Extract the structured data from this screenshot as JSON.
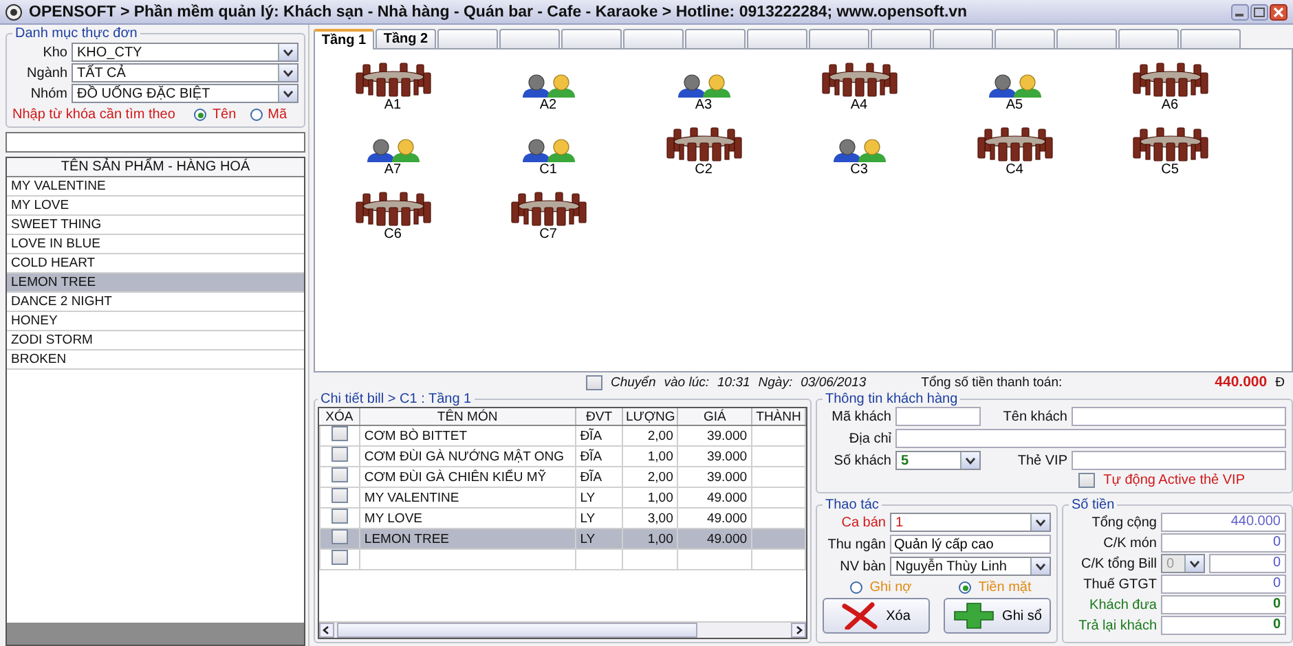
{
  "window": {
    "title": "OPENSOFT > Phần mềm quản lý: Khách sạn - Nhà hàng - Quán bar - Cafe - Karaoke > Hotline: 0913222284; www.opensoft.vn"
  },
  "menu_panel": {
    "title": "Danh mục thực đơn",
    "filters": [
      {
        "label": "Kho",
        "value": "KHO_CTY"
      },
      {
        "label": "Ngành",
        "value": "TẤT CẢ"
      },
      {
        "label": "Nhóm",
        "value": "ĐỒ UỐNG ĐẶC BIỆT"
      }
    ],
    "search_label": "Nhập từ khóa cần tìm theo",
    "search_by": [
      {
        "label": "Tên",
        "selected": true
      },
      {
        "label": "Mã",
        "selected": false
      }
    ]
  },
  "products": {
    "header": "TÊN SẢN PHẨM - HÀNG HOÁ",
    "items": [
      {
        "name": "MY VALENTINE",
        "selected": false
      },
      {
        "name": "MY LOVE",
        "selected": false
      },
      {
        "name": "SWEET THING",
        "selected": false
      },
      {
        "name": "LOVE IN BLUE",
        "selected": false
      },
      {
        "name": "COLD HEART",
        "selected": false
      },
      {
        "name": "LEMON TREE",
        "selected": true
      },
      {
        "name": "DANCE 2 NIGHT",
        "selected": false
      },
      {
        "name": "HONEY",
        "selected": false
      },
      {
        "name": "ZODI STORM",
        "selected": false
      },
      {
        "name": "BROKEN",
        "selected": false
      }
    ]
  },
  "floor_tabs": [
    {
      "label": "Tầng 1",
      "selected": true
    },
    {
      "label": "Tầng 2",
      "selected": false
    },
    {
      "selected": false
    },
    {
      "selected": false
    },
    {
      "selected": false
    },
    {
      "selected": false
    },
    {
      "selected": false
    },
    {
      "selected": false
    },
    {
      "selected": false
    },
    {
      "selected": false
    },
    {
      "selected": false
    },
    {
      "selected": false
    },
    {
      "selected": false
    },
    {
      "selected": false
    },
    {
      "selected": false
    }
  ],
  "tables": [
    {
      "name": "A1",
      "kind": "free"
    },
    {
      "name": "A2",
      "kind": "occupied"
    },
    {
      "name": "A3",
      "kind": "occupied"
    },
    {
      "name": "A4",
      "kind": "free"
    },
    {
      "name": "A5",
      "kind": "occupied"
    },
    {
      "name": "A6",
      "kind": "free"
    },
    {
      "name": "A7",
      "kind": "occupied"
    },
    {
      "name": "C1",
      "kind": "occupied"
    },
    {
      "name": "C2",
      "kind": "free"
    },
    {
      "name": "C3",
      "kind": "occupied"
    },
    {
      "name": "C4",
      "kind": "free"
    },
    {
      "name": "C5",
      "kind": "free"
    },
    {
      "name": "C6",
      "kind": "free"
    },
    {
      "name": "C7",
      "kind": "free"
    }
  ],
  "transfer": {
    "checked": false,
    "label": "Chuyển",
    "time_label": "vào lúc:",
    "time": "10:31",
    "date_label": "Ngày:",
    "date": "03/06/2013"
  },
  "payment_total": {
    "label": "Tổng số tiền thanh toán:",
    "amount": "440.000",
    "currency": "Đ"
  },
  "bill": {
    "title": "Chi tiết bill > C1  :  Tầng 1",
    "columns": [
      "XÓA",
      "TÊN MÓN",
      "ĐVT",
      "LƯỢNG",
      "GIÁ",
      "THÀNH"
    ],
    "rows": [
      {
        "checked": false,
        "selected": false,
        "cells": [
          "CƠM BÒ BITTET",
          "ĐĨA",
          "2,00",
          "39.000"
        ]
      },
      {
        "checked": false,
        "selected": false,
        "cells": [
          "CƠM ĐÙI GÀ NƯỚNG MẬT ONG",
          "ĐĨA",
          "1,00",
          "39.000"
        ]
      },
      {
        "checked": false,
        "selected": false,
        "cells": [
          "CƠM ĐÙI GÀ CHIÊN KIỂU MỸ",
          "ĐĨA",
          "2,00",
          "39.000"
        ]
      },
      {
        "checked": false,
        "selected": false,
        "cells": [
          "MY VALENTINE",
          "LY",
          "1,00",
          "49.000"
        ]
      },
      {
        "checked": false,
        "selected": false,
        "cells": [
          "MY LOVE",
          "LY",
          "3,00",
          "49.000"
        ]
      },
      {
        "checked": false,
        "selected": true,
        "cells": [
          "LEMON TREE",
          "LY",
          "1,00",
          "49.000"
        ]
      },
      {
        "checked": false,
        "selected": false
      }
    ]
  },
  "customer": {
    "title": "Thông tin khách hàng",
    "code_label": "Mã khách",
    "name_label": "Tên khách",
    "address_label": "Địa chỉ",
    "guests_label": "Số khách",
    "guests": "5",
    "vip_label": "Thẻ VIP",
    "auto_vip": {
      "label": "Tự động Active thẻ VIP",
      "checked": false
    }
  },
  "actions": {
    "title": "Thao tác",
    "fields": [
      {
        "label": "Ca bán",
        "value": "1",
        "kind": "dropdown",
        "required": true
      },
      {
        "label": "Thu ngân",
        "value": "Quản lý cấp cao",
        "kind": "text",
        "required": false
      },
      {
        "label": "NV bàn",
        "value": "Nguyễn Thùy Linh",
        "kind": "dropdown",
        "required": false
      }
    ],
    "payment_modes": [
      {
        "label": "Ghi nợ",
        "selected": false
      },
      {
        "label": "Tiền mặt",
        "selected": true
      }
    ],
    "buttons": [
      {
        "label": "Xóa",
        "kind": "delete"
      },
      {
        "label": "Ghi sổ",
        "kind": "save"
      }
    ]
  },
  "amounts": {
    "title": "Số tiền",
    "rows": [
      {
        "label": "Tổng cộng",
        "value": "440.000",
        "kind": "total"
      },
      {
        "label": "C/K món",
        "value": "0",
        "kind": "plain"
      },
      {
        "label": "C/K tổng Bill",
        "value": "0",
        "kind": "discount",
        "rate": "0",
        "rate_disabled": true
      },
      {
        "label": "Thuế GTGT",
        "value": "0",
        "kind": "plain"
      },
      {
        "label": "Khách đưa",
        "value": "0",
        "kind": "cash"
      },
      {
        "label": "Trả lại khách",
        "value": "0",
        "kind": "cash"
      }
    ]
  }
}
